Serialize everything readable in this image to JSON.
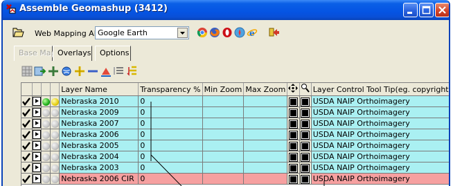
{
  "window": {
    "title": "Assemble Geomashup (3412)"
  },
  "toolbar": {
    "api_label": "Web Mapping API",
    "api_value": "Google Earth",
    "api_icons": [
      "chrome-icon",
      "firefox-icon",
      "opera-icon",
      "safari-icon",
      "ie-icon"
    ]
  },
  "tabs": [
    {
      "label": "Base Maps",
      "state": "disabled"
    },
    {
      "label": "Overlays",
      "state": "active"
    },
    {
      "label": "Options",
      "state": "normal"
    }
  ],
  "row_icons": [
    "grid-icon",
    "import-icon",
    "add-layer-icon",
    "globe-icon",
    "add-icon",
    "remove-icon",
    "move-up-icon",
    "list-icon",
    "sort-icon"
  ],
  "table": {
    "headers": {
      "layer_name": "Layer Name",
      "transparency": "Transparency %",
      "min_zoom": "Min Zoom",
      "max_zoom": "Max Zoom",
      "tooltip": "Layer Control Tool Tip(eg. copyright)"
    },
    "rows": [
      {
        "name": "Nebraska 2010",
        "transparency": "0",
        "tooltip": "USDA NAIP Orthoimagery",
        "status": "active"
      },
      {
        "name": "Nebraska 2009",
        "transparency": "0",
        "tooltip": "USDA NAIP Orthoimagery",
        "status": "inactive"
      },
      {
        "name": "Nebraska 2007",
        "transparency": "0",
        "tooltip": "USDA NAIP Orthoimagery",
        "status": "inactive"
      },
      {
        "name": "Nebraska 2006",
        "transparency": "0",
        "tooltip": "USDA NAIP Orthoimagery",
        "status": "inactive"
      },
      {
        "name": "Nebraska 2005",
        "transparency": "0",
        "tooltip": "USDA NAIP Orthoimagery",
        "status": "inactive"
      },
      {
        "name": "Nebraska 2004",
        "transparency": "0",
        "tooltip": "USDA NAIP Orthoimagery",
        "status": "inactive"
      },
      {
        "name": "Nebraska 2003",
        "transparency": "0",
        "tooltip": "USDA NAIP Orthoimagery",
        "status": "inactive"
      },
      {
        "name": "Nebraska 2006 CIR",
        "transparency": "0",
        "tooltip": "USDA NAIP Orthoimagery",
        "status": "inactive"
      }
    ]
  },
  "colors": {
    "row_cyan": "#aaf0f2",
    "row_pink": "#f6a0a0",
    "titlebar": "#0554e3"
  }
}
